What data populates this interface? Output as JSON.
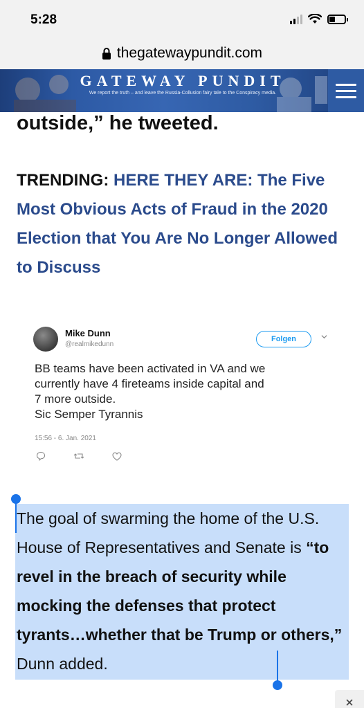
{
  "status": {
    "time": "5:28"
  },
  "browser": {
    "url": "thegatewaypundit.com"
  },
  "site": {
    "name": "GATEWAY PUNDIT",
    "tagline": "We report the truth – and leave the Russia-Collusion fairy tale to the Conspiracy media."
  },
  "article": {
    "cut_text": "outside,” he tweeted.",
    "trending_label": "TRENDING: ",
    "trending_link": "HERE THEY ARE: The Five Most Obvious Acts of Fraud in the 2020 Election that You Are No Longer Allowed to Discuss"
  },
  "tweet": {
    "name": "Mike Dunn",
    "handle": "@realmikedunn",
    "follow_label": "Folgen",
    "lines": [
      "BB teams have been activated in VA and we",
      "currently have 4 fireteams inside capital and",
      "7 more outside.",
      "Sic Semper Tyrannis"
    ],
    "date": "15:56 - 6. Jan. 2021"
  },
  "paragraph": {
    "intro": "The goal of swarming the home of the U.S. House of Representatives and Senate is ",
    "quote": "“to revel in the breach of security while mocking the defenses that protect tyrants…whether that be Trump or others,”",
    "outro": " Dunn added."
  },
  "colors": {
    "link": "#2b4b8c",
    "banner": "#2e5ba3",
    "selection": "#c8defa",
    "handle": "#1a73e8",
    "follow": "#1d9bf0"
  }
}
